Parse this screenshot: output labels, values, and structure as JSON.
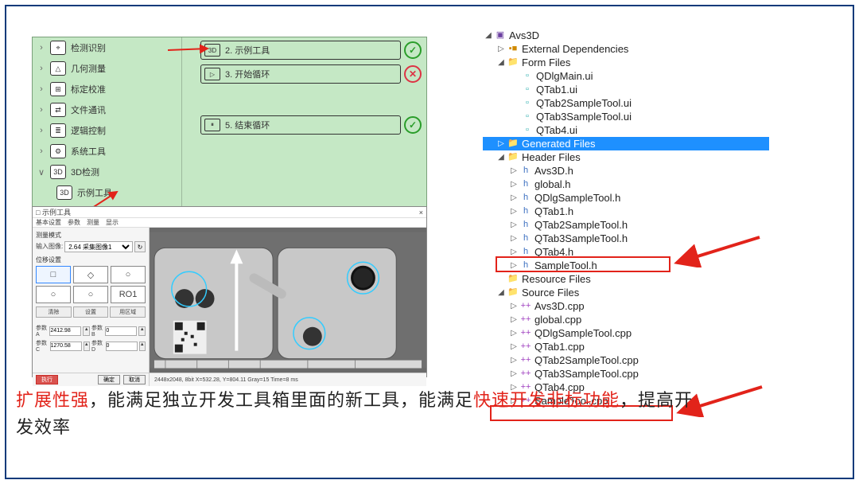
{
  "green_panel": {
    "categories": [
      {
        "chev": "›",
        "label": "检测识别"
      },
      {
        "chev": "›",
        "label": "几何测量"
      },
      {
        "chev": "›",
        "label": "标定校准"
      },
      {
        "chev": "›",
        "label": "文件通讯"
      },
      {
        "chev": "›",
        "label": "逻辑控制"
      },
      {
        "chev": "›",
        "label": "系统工具"
      },
      {
        "chev": "∨",
        "label": "3D检测"
      }
    ],
    "sub_item": "示例工具",
    "steps": [
      {
        "icon": "3D",
        "label": "2. 示例工具",
        "status": "ok",
        "mark": "✓"
      },
      {
        "icon": "▷",
        "label": "3. 开始循环",
        "status": "err",
        "mark": "✕"
      },
      {
        "icon": "⏸",
        "label": "5. 结束循环",
        "status": "ok",
        "mark": "✓"
      }
    ]
  },
  "tool_window": {
    "title_icon": "□",
    "title": "示例工具",
    "menu": [
      "基本设置",
      "参数",
      "测量",
      "显示"
    ],
    "sidebar": {
      "group1": "测量模式",
      "input_label": "输入图像:",
      "combo": "2.64 采集图像1",
      "refresh": "↻",
      "group2": "位移设置",
      "shapes": [
        "□",
        "◇",
        "○",
        "○",
        "○",
        "RO1"
      ],
      "util_buttons": [
        "清除",
        "设置",
        "用区域"
      ],
      "params": [
        {
          "label": "参数A",
          "value": "2412.98"
        },
        {
          "label": "参数B",
          "value": "0"
        },
        {
          "label": "参数C",
          "value": "1270.58"
        },
        {
          "label": "参数D",
          "value": "0"
        }
      ]
    },
    "footer": {
      "run": "执行",
      "ok": "确定",
      "cancel": "取消",
      "status": "2448x2048, 8bit      X=532.28, Y=804.11      Gray=15            Time=8 ms"
    }
  },
  "tree": {
    "root": "Avs3D",
    "ext_deps": "External Dependencies",
    "form_files": "Form Files",
    "forms": [
      "QDlgMain.ui",
      "QTab1.ui",
      "QTab2SampleTool.ui",
      "QTab3SampleTool.ui",
      "QTab4.ui"
    ],
    "generated": "Generated Files",
    "header_files": "Header Files",
    "headers": [
      "Avs3D.h",
      "global.h",
      "QDlgSampleTool.h",
      "QTab1.h",
      "QTab2SampleTool.h",
      "QTab3SampleTool.h",
      "QTab4.h",
      "SampleTool.h"
    ],
    "resource_files": "Resource Files",
    "source_files": "Source Files",
    "sources": [
      "Avs3D.cpp",
      "global.cpp",
      "QDlgSampleTool.cpp",
      "QTab1.cpp",
      "QTab2SampleTool.cpp",
      "QTab3SampleTool.cpp",
      "QTab4.cpp",
      "SampleTool.cpp"
    ]
  },
  "caption": {
    "p1a": "扩展性强",
    "p1b": "，能满足独立开发工具箱里面的新工具，能满足",
    "p1c": "快速开发非标功能",
    "p1d": "，提高开",
    "p2": "发效率"
  },
  "glyphs": {
    "tri_open": "◢",
    "tri_closed": "▷",
    "folder": "📁",
    "page": "▫",
    "ref_icon": "▪■",
    "h_icon": "h",
    "cpp_icon": "++",
    "proj_icon": "▣"
  }
}
